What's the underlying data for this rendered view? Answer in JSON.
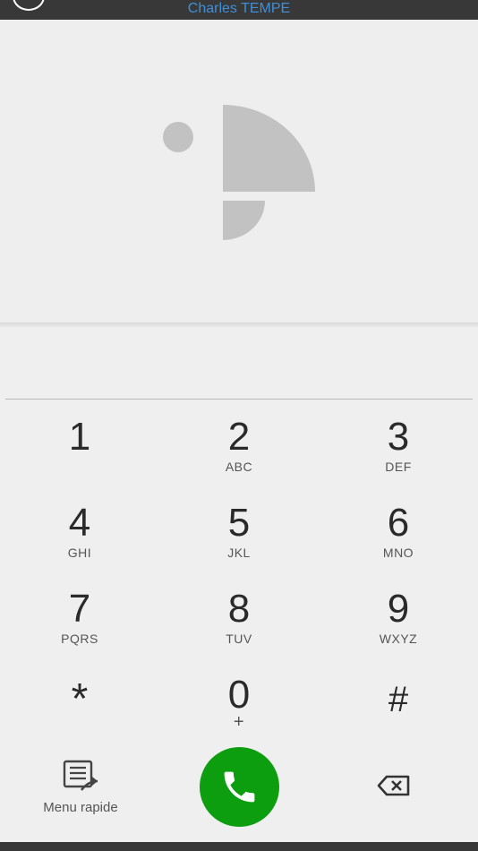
{
  "header": {
    "contact_name": "Charles TEMPE"
  },
  "dialer": {
    "number": ""
  },
  "keypad": [
    {
      "digit": "1",
      "letters": ""
    },
    {
      "digit": "2",
      "letters": "ABC"
    },
    {
      "digit": "3",
      "letters": "DEF"
    },
    {
      "digit": "4",
      "letters": "GHI"
    },
    {
      "digit": "5",
      "letters": "JKL"
    },
    {
      "digit": "6",
      "letters": "MNO"
    },
    {
      "digit": "7",
      "letters": "PQRS"
    },
    {
      "digit": "8",
      "letters": "TUV"
    },
    {
      "digit": "9",
      "letters": "WXYZ"
    },
    {
      "digit": "*",
      "letters": ""
    },
    {
      "digit": "0",
      "letters": "+"
    },
    {
      "digit": "#",
      "letters": ""
    }
  ],
  "actions": {
    "menu_rapide_label": "Menu rapide",
    "menu_rapide_icon": "list-icon",
    "call_icon": "phone-icon",
    "backspace_icon": "backspace-icon"
  },
  "colors": {
    "accent": "#3f8fd8",
    "call_green": "#0d9e10",
    "bar_dark": "#383838",
    "logo_gray": "#c2c2c2"
  }
}
